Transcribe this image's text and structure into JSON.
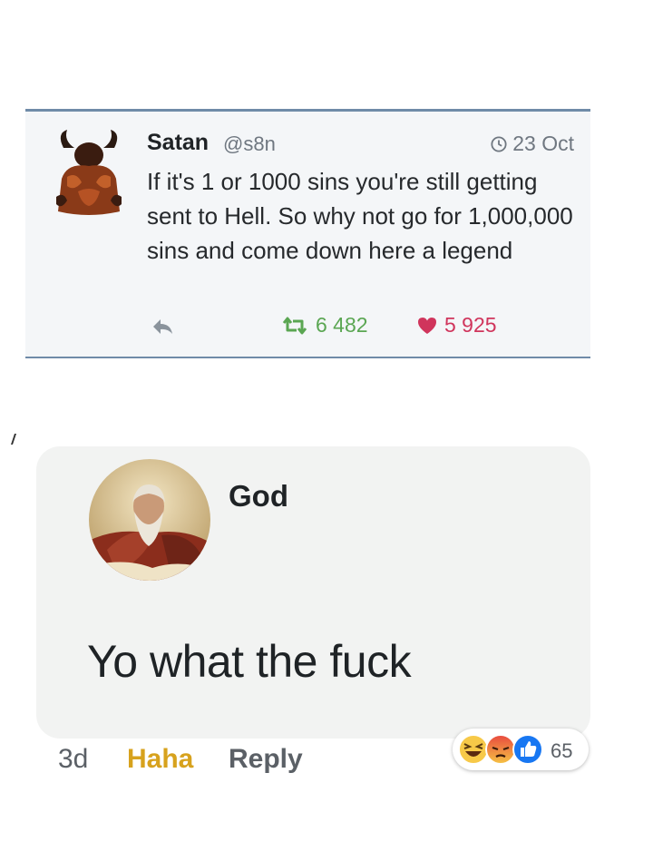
{
  "tweet": {
    "author_name": "Satan",
    "handle": "@s8n",
    "date": "23 Oct",
    "text": "If it's 1 or 1000 sins you're still getting sent to Hell. So why not go for 1,000,000 sins and come down here a legend",
    "retweets": "6 482",
    "likes": "5 925",
    "icons": [
      "devil-avatar-icon",
      "clock-icon",
      "reply-icon",
      "retweet-icon",
      "heart-icon"
    ],
    "colors": {
      "retweet": "#5aa652",
      "like": "#d0355c",
      "border": "#6f8ba8"
    }
  },
  "comment": {
    "author_name": "God",
    "text": "Yo what the fuck",
    "time": "3d",
    "reaction_label": "Haha",
    "reply_label": "Reply",
    "reaction_count": "65",
    "reaction_icons": [
      "haha-emoji-icon",
      "angry-emoji-icon",
      "like-thumb-icon"
    ],
    "colors": {
      "haha": "#d7a21d",
      "like_badge": "#1877f2"
    }
  }
}
